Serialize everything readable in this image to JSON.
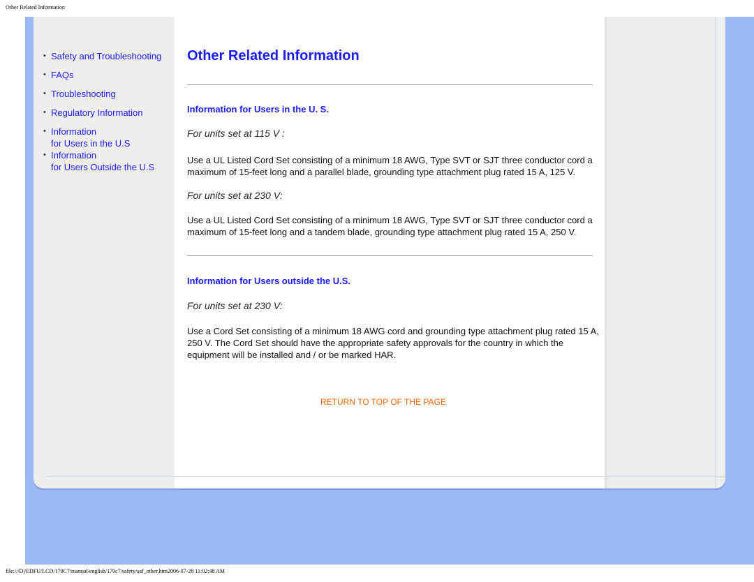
{
  "page_header": "Other Related Information",
  "sidebar": {
    "items": [
      {
        "label": "Safety and Troubleshooting"
      },
      {
        "label": "FAQs"
      },
      {
        "label": "Troubleshooting"
      },
      {
        "label": "Regulatory Information"
      },
      {
        "label_line1": "Information",
        "label_line2": "for Users in the U.S"
      },
      {
        "label_line1": "Information",
        "label_line2": "for Users Outside the U.S"
      }
    ]
  },
  "main": {
    "title": "Other Related Information",
    "section_us": {
      "heading": "Information for Users in the U. S.",
      "sub1": "For units set at 115 V :",
      "para1": "Use a UL Listed Cord Set consisting of a minimum 18 AWG, Type SVT or SJT three conductor cord a maximum of 15-feet long and a parallel blade, grounding type attachment plug rated 15 A, 125 V.",
      "sub2": "For units set at 230 V:",
      "para2": "Use a UL Listed Cord Set consisting of a minimum 18 AWG, Type SVT or SJT three conductor cord a maximum of 15-feet long and a tandem blade, grounding type attachment plug rated 15 A, 250 V."
    },
    "section_outside": {
      "heading": "Information for Users outside the U.S.",
      "sub1": "For units set at 230 V:",
      "para1": "Use a Cord Set consisting of a minimum 18 AWG cord and grounding type attachment plug rated 15 A, 250 V. The Cord Set should have the appropriate safety approvals for the country in which the equipment will be installed and / or be marked HAR."
    },
    "return_link": "RETURN TO TOP OF THE PAGE"
  },
  "footer": "file:///D|/EDFU/LCD/170C7/manual/english/170c7/safety/saf_other.htm2006-07-28 11:02:48 AM",
  "colors": {
    "link": "#1a1aff",
    "return_link": "#ff6600",
    "frame": "#99b9f7",
    "panel": "#eeeeee"
  }
}
